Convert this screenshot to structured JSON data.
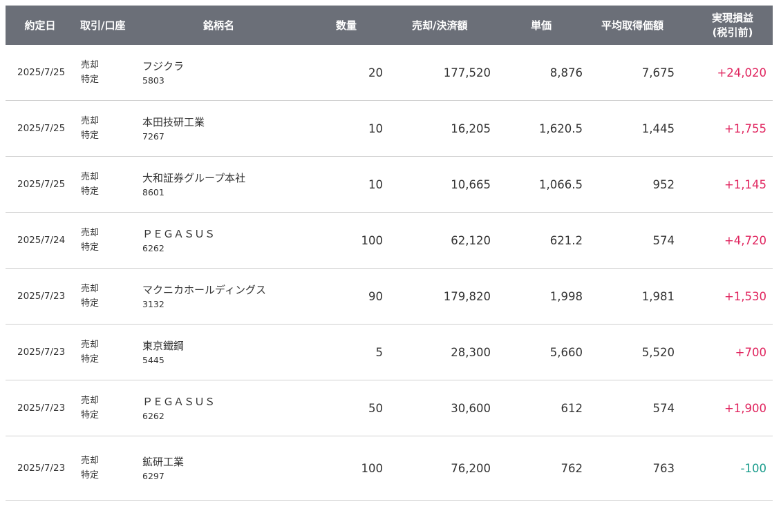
{
  "colors": {
    "header_bg": "#6b6f78",
    "gain": "#e0245e",
    "loss": "#1a9c8c"
  },
  "header": {
    "date": "約定日",
    "type": "取引/口座",
    "name": "銘柄名",
    "qty": "数量",
    "amount": "売却/決済額",
    "unit": "単価",
    "avg": "平均取得価額",
    "pnl_line1": "実現損益",
    "pnl_line2": "(税引前)"
  },
  "rows": [
    {
      "date": "2025/7/25",
      "trade": "売却",
      "account": "特定",
      "name": "フジクラ",
      "code": "5803",
      "qty": "20",
      "amount": "177,520",
      "unit": "8,876",
      "avg": "7,675",
      "pnl": "+24,020",
      "sign": "pos"
    },
    {
      "date": "2025/7/25",
      "trade": "売却",
      "account": "特定",
      "name": "本田技研工業",
      "code": "7267",
      "qty": "10",
      "amount": "16,205",
      "unit": "1,620.5",
      "avg": "1,445",
      "pnl": "+1,755",
      "sign": "pos"
    },
    {
      "date": "2025/7/25",
      "trade": "売却",
      "account": "特定",
      "name": "大和証券グループ本社",
      "code": "8601",
      "qty": "10",
      "amount": "10,665",
      "unit": "1,066.5",
      "avg": "952",
      "pnl": "+1,145",
      "sign": "pos"
    },
    {
      "date": "2025/7/24",
      "trade": "売却",
      "account": "特定",
      "name": "ＰＥＧＡＳＵＳ",
      "code": "6262",
      "qty": "100",
      "amount": "62,120",
      "unit": "621.2",
      "avg": "574",
      "pnl": "+4,720",
      "sign": "pos"
    },
    {
      "date": "2025/7/23",
      "trade": "売却",
      "account": "特定",
      "name": "マクニカホールディングス",
      "code": "3132",
      "qty": "90",
      "amount": "179,820",
      "unit": "1,998",
      "avg": "1,981",
      "pnl": "+1,530",
      "sign": "pos"
    },
    {
      "date": "2025/7/23",
      "trade": "売却",
      "account": "特定",
      "name": "東京鐵鋼",
      "code": "5445",
      "qty": "5",
      "amount": "28,300",
      "unit": "5,660",
      "avg": "5,520",
      "pnl": "+700",
      "sign": "pos"
    },
    {
      "date": "2025/7/23",
      "trade": "売却",
      "account": "特定",
      "name": "ＰＥＧＡＳＵＳ",
      "code": "6262",
      "qty": "50",
      "amount": "30,600",
      "unit": "612",
      "avg": "574",
      "pnl": "+1,900",
      "sign": "pos"
    },
    {
      "date": "2025/7/23",
      "trade": "売却",
      "account": "特定",
      "name": "鉱研工業",
      "code": "6297",
      "qty": "100",
      "amount": "76,200",
      "unit": "762",
      "avg": "763",
      "pnl": "-100",
      "sign": "neg"
    }
  ]
}
